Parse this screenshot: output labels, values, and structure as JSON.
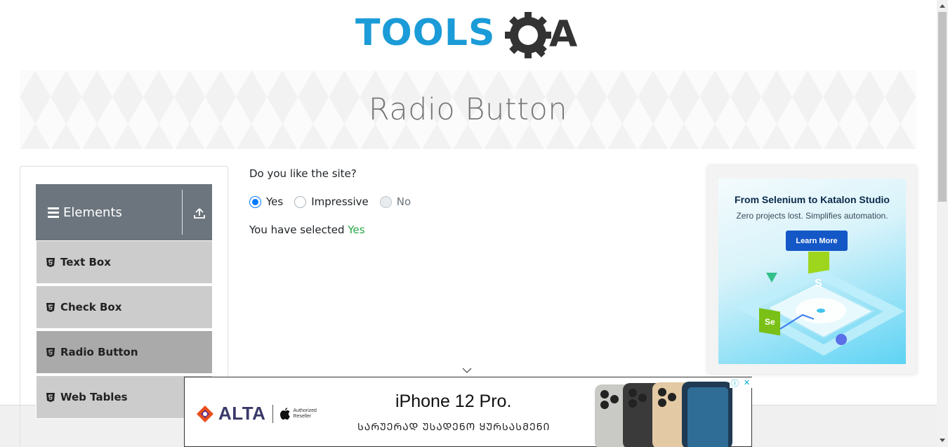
{
  "logo": {
    "text_left": "TOOLS",
    "text_right": "A"
  },
  "banner": {
    "title": "Radio Button"
  },
  "sidebar": {
    "group": {
      "label": "Elements"
    },
    "items": [
      {
        "label": "Text Box"
      },
      {
        "label": "Check Box"
      },
      {
        "label": "Radio Button"
      },
      {
        "label": "Web Tables"
      }
    ]
  },
  "main": {
    "question": "Do you like the site?",
    "options": [
      {
        "label": "Yes"
      },
      {
        "label": "Impressive"
      },
      {
        "label": "No"
      }
    ],
    "selected_prefix": "You have selected",
    "selected_value": "Yes"
  },
  "ad_right": {
    "title": "From Selenium to Katalon Studio",
    "subtitle": "Zero projects lost. Simplifies automation.",
    "button": "Learn More"
  },
  "ad_bottom": {
    "brand": "ALTA",
    "apple_line1": "Authorized",
    "apple_line2": "Reseller",
    "title": "iPhone 12 Pro.",
    "subtitle": "ᲡᲐᲠᲣᲔᲠᲐᲓ ᲣᲡᲐᲓᲔᲜᲝ ᲧᲣᲠᲡᲐᲡᲛᲔᲜᲘ"
  },
  "colors": {
    "brand_blue": "#1b9bd7",
    "brand_dark": "#333333",
    "accent": "#007bff",
    "success": "#28a745",
    "sidebar_header": "#6c757d"
  }
}
